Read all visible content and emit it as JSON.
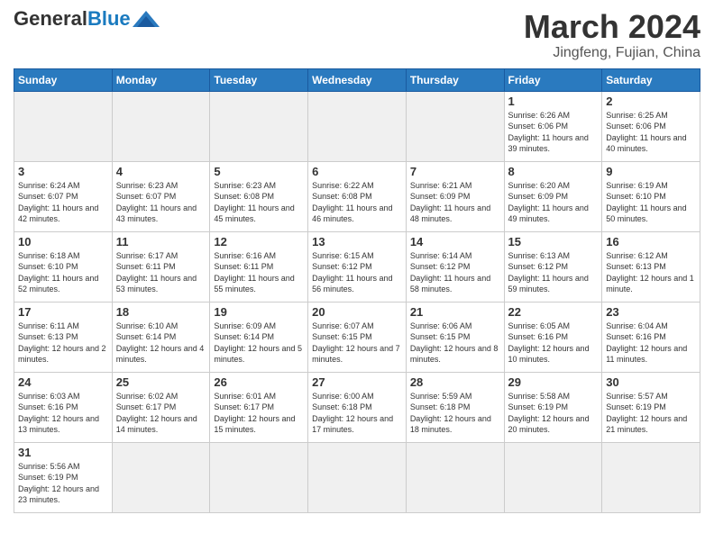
{
  "header": {
    "logo_general": "General",
    "logo_blue": "Blue",
    "title": "March 2024",
    "subtitle": "Jingfeng, Fujian, China"
  },
  "days_of_week": [
    "Sunday",
    "Monday",
    "Tuesday",
    "Wednesday",
    "Thursday",
    "Friday",
    "Saturday"
  ],
  "weeks": [
    [
      {
        "day": "",
        "info": ""
      },
      {
        "day": "",
        "info": ""
      },
      {
        "day": "",
        "info": ""
      },
      {
        "day": "",
        "info": ""
      },
      {
        "day": "",
        "info": ""
      },
      {
        "day": "1",
        "info": "Sunrise: 6:26 AM\nSunset: 6:06 PM\nDaylight: 11 hours and 39 minutes."
      },
      {
        "day": "2",
        "info": "Sunrise: 6:25 AM\nSunset: 6:06 PM\nDaylight: 11 hours and 40 minutes."
      }
    ],
    [
      {
        "day": "3",
        "info": "Sunrise: 6:24 AM\nSunset: 6:07 PM\nDaylight: 11 hours and 42 minutes."
      },
      {
        "day": "4",
        "info": "Sunrise: 6:23 AM\nSunset: 6:07 PM\nDaylight: 11 hours and 43 minutes."
      },
      {
        "day": "5",
        "info": "Sunrise: 6:23 AM\nSunset: 6:08 PM\nDaylight: 11 hours and 45 minutes."
      },
      {
        "day": "6",
        "info": "Sunrise: 6:22 AM\nSunset: 6:08 PM\nDaylight: 11 hours and 46 minutes."
      },
      {
        "day": "7",
        "info": "Sunrise: 6:21 AM\nSunset: 6:09 PM\nDaylight: 11 hours and 48 minutes."
      },
      {
        "day": "8",
        "info": "Sunrise: 6:20 AM\nSunset: 6:09 PM\nDaylight: 11 hours and 49 minutes."
      },
      {
        "day": "9",
        "info": "Sunrise: 6:19 AM\nSunset: 6:10 PM\nDaylight: 11 hours and 50 minutes."
      }
    ],
    [
      {
        "day": "10",
        "info": "Sunrise: 6:18 AM\nSunset: 6:10 PM\nDaylight: 11 hours and 52 minutes."
      },
      {
        "day": "11",
        "info": "Sunrise: 6:17 AM\nSunset: 6:11 PM\nDaylight: 11 hours and 53 minutes."
      },
      {
        "day": "12",
        "info": "Sunrise: 6:16 AM\nSunset: 6:11 PM\nDaylight: 11 hours and 55 minutes."
      },
      {
        "day": "13",
        "info": "Sunrise: 6:15 AM\nSunset: 6:12 PM\nDaylight: 11 hours and 56 minutes."
      },
      {
        "day": "14",
        "info": "Sunrise: 6:14 AM\nSunset: 6:12 PM\nDaylight: 11 hours and 58 minutes."
      },
      {
        "day": "15",
        "info": "Sunrise: 6:13 AM\nSunset: 6:12 PM\nDaylight: 11 hours and 59 minutes."
      },
      {
        "day": "16",
        "info": "Sunrise: 6:12 AM\nSunset: 6:13 PM\nDaylight: 12 hours and 1 minute."
      }
    ],
    [
      {
        "day": "17",
        "info": "Sunrise: 6:11 AM\nSunset: 6:13 PM\nDaylight: 12 hours and 2 minutes."
      },
      {
        "day": "18",
        "info": "Sunrise: 6:10 AM\nSunset: 6:14 PM\nDaylight: 12 hours and 4 minutes."
      },
      {
        "day": "19",
        "info": "Sunrise: 6:09 AM\nSunset: 6:14 PM\nDaylight: 12 hours and 5 minutes."
      },
      {
        "day": "20",
        "info": "Sunrise: 6:07 AM\nSunset: 6:15 PM\nDaylight: 12 hours and 7 minutes."
      },
      {
        "day": "21",
        "info": "Sunrise: 6:06 AM\nSunset: 6:15 PM\nDaylight: 12 hours and 8 minutes."
      },
      {
        "day": "22",
        "info": "Sunrise: 6:05 AM\nSunset: 6:16 PM\nDaylight: 12 hours and 10 minutes."
      },
      {
        "day": "23",
        "info": "Sunrise: 6:04 AM\nSunset: 6:16 PM\nDaylight: 12 hours and 11 minutes."
      }
    ],
    [
      {
        "day": "24",
        "info": "Sunrise: 6:03 AM\nSunset: 6:16 PM\nDaylight: 12 hours and 13 minutes."
      },
      {
        "day": "25",
        "info": "Sunrise: 6:02 AM\nSunset: 6:17 PM\nDaylight: 12 hours and 14 minutes."
      },
      {
        "day": "26",
        "info": "Sunrise: 6:01 AM\nSunset: 6:17 PM\nDaylight: 12 hours and 15 minutes."
      },
      {
        "day": "27",
        "info": "Sunrise: 6:00 AM\nSunset: 6:18 PM\nDaylight: 12 hours and 17 minutes."
      },
      {
        "day": "28",
        "info": "Sunrise: 5:59 AM\nSunset: 6:18 PM\nDaylight: 12 hours and 18 minutes."
      },
      {
        "day": "29",
        "info": "Sunrise: 5:58 AM\nSunset: 6:19 PM\nDaylight: 12 hours and 20 minutes."
      },
      {
        "day": "30",
        "info": "Sunrise: 5:57 AM\nSunset: 6:19 PM\nDaylight: 12 hours and 21 minutes."
      }
    ],
    [
      {
        "day": "31",
        "info": "Sunrise: 5:56 AM\nSunset: 6:19 PM\nDaylight: 12 hours and 23 minutes."
      },
      {
        "day": "",
        "info": ""
      },
      {
        "day": "",
        "info": ""
      },
      {
        "day": "",
        "info": ""
      },
      {
        "day": "",
        "info": ""
      },
      {
        "day": "",
        "info": ""
      },
      {
        "day": "",
        "info": ""
      }
    ]
  ]
}
